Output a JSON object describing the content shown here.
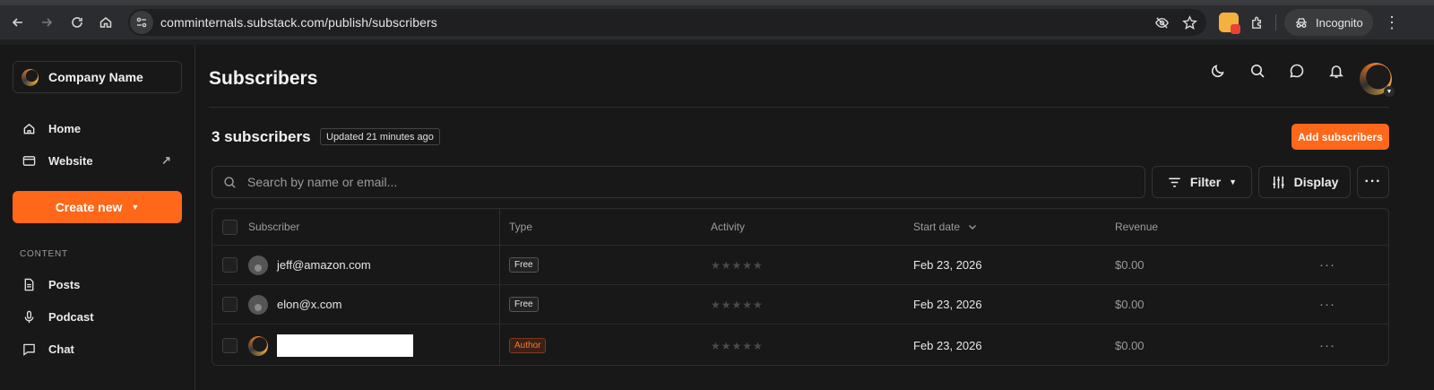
{
  "browser": {
    "url": "comminternals.substack.com/publish/subscribers",
    "incognito_label": "Incognito"
  },
  "sidebar": {
    "company_name": "Company Name",
    "nav": [
      {
        "label": "Home",
        "icon": "home-icon"
      },
      {
        "label": "Website",
        "icon": "website-icon"
      }
    ],
    "create_label": "Create new",
    "content_section": "CONTENT",
    "content_items": [
      {
        "label": "Posts",
        "icon": "posts-icon"
      },
      {
        "label": "Podcast",
        "icon": "microphone-icon"
      },
      {
        "label": "Chat",
        "icon": "chat-icon"
      }
    ]
  },
  "main": {
    "title": "Subscribers",
    "count_label": "3 subscribers",
    "updated_label": "Updated 21 minutes ago",
    "add_button": "Add subscribers",
    "search_placeholder": "Search by name or email...",
    "filter_label": "Filter",
    "display_label": "Display"
  },
  "table": {
    "headers": {
      "subscriber": "Subscriber",
      "type": "Type",
      "activity": "Activity",
      "start_date": "Start date",
      "revenue": "Revenue"
    },
    "rows": [
      {
        "email": "jeff@amazon.com",
        "type": "Free",
        "activity_stars": 0,
        "start_date": "Feb 23, 2026",
        "revenue": "$0.00"
      },
      {
        "email": "elon@x.com",
        "type": "Free",
        "activity_stars": 0,
        "start_date": "Feb 23, 2026",
        "revenue": "$0.00"
      },
      {
        "email": "",
        "type": "Author",
        "activity_stars": 0,
        "start_date": "Feb 23, 2026",
        "revenue": "$0.00"
      }
    ]
  },
  "colors": {
    "accent": "#ff6719",
    "background": "#181818"
  }
}
